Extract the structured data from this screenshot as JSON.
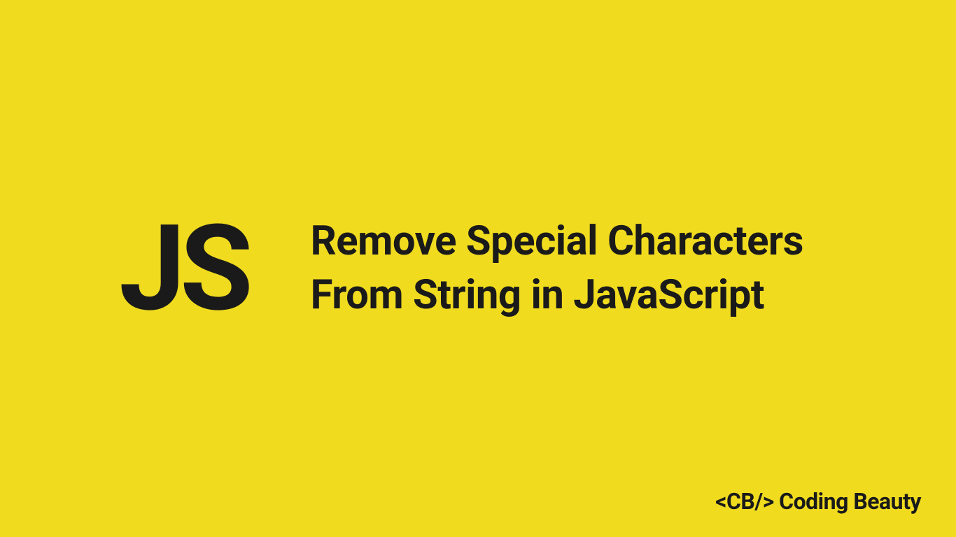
{
  "badge": "JS",
  "title": "Remove Special Characters From String in JavaScript",
  "footer": {
    "tag": "<CB/>",
    "name": "Coding Beauty"
  },
  "colors": {
    "background": "#f0db1f",
    "text": "#1a1a1a"
  }
}
